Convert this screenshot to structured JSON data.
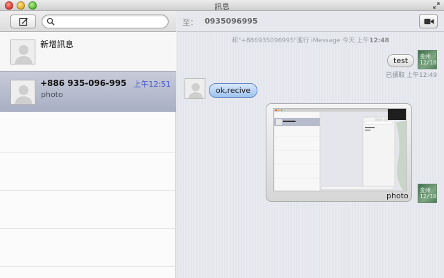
{
  "window": {
    "title": "訊息"
  },
  "sidebar": {
    "search": {
      "placeholder": "",
      "value": ""
    },
    "conversations": [
      {
        "title": "新增訊息",
        "time": "",
        "preview": ""
      },
      {
        "title": "+886 935-096-995",
        "time": "上午12:51",
        "preview": "photo"
      }
    ]
  },
  "main": {
    "to_label": "至：",
    "to_value": "0935096995",
    "status_prefix": "和\"+886935096995\"進行 iMessage 今天 上午",
    "status_time": "12:48",
    "messages": [
      {
        "direction": "outgoing",
        "text": "test"
      },
      {
        "direction": "incoming",
        "text": "ok,recive"
      },
      {
        "direction": "outgoing",
        "text": "photo",
        "type": "image"
      }
    ],
    "read_receipt": "已讀取 上午12:49",
    "avatar_text": "金州\n12/10"
  },
  "colors": {
    "accent": "#3a4fd0",
    "selected_row": "#b4b9cc",
    "incoming_bubble": "#9ec2ee"
  }
}
